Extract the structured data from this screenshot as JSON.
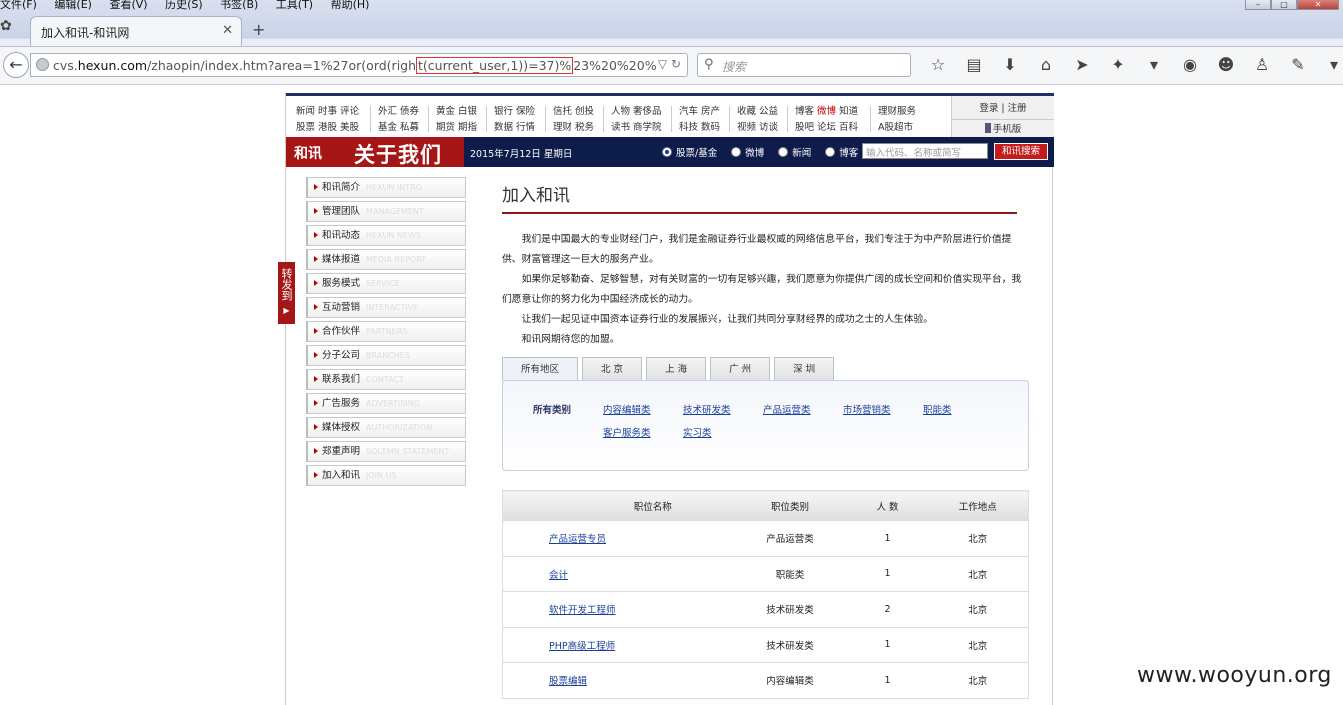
{
  "browser": {
    "menu": [
      "文件(F)",
      "编辑(E)",
      "查看(V)",
      "历史(S)",
      "书签(B)",
      "工具(T)",
      "帮助(H)"
    ],
    "tab_title": "加入和讯-和讯网",
    "url_pre": "cvs.",
    "url_host": "hexun.com",
    "url_mid": "/zhaopin/index.htm?area=1%27or(ord(righ",
    "url_hl": "t(current_user,1))=37)%",
    "url_post": "23%20%20%",
    "search_placeholder": "搜索"
  },
  "topnav": {
    "groups": [
      [
        "新闻 时事 评论",
        "股票 港股 美股"
      ],
      [
        "外汇 债券",
        "基金 私募"
      ],
      [
        "黄金 白银",
        "期货 期指"
      ],
      [
        "银行 保险",
        "数据 行情"
      ],
      [
        "信托 创投",
        "理财 税务"
      ],
      [
        "人物 奢侈品",
        "读书 商学院"
      ],
      [
        "汽车 房产",
        "科技 数码"
      ],
      [
        "收藏 公益",
        "视频 访谈"
      ],
      [
        "博客 ",
        "股吧 论坛 百科"
      ],
      [
        "理财服务",
        "A股超市"
      ]
    ],
    "weibo": "微博",
    "zhidao": " 知道",
    "login": "登录",
    "register": "注册",
    "mobile": "手机版"
  },
  "band": {
    "logo_hexun": "和讯",
    "logo_title": "关于我们",
    "date": "2015年7月12日  星期日",
    "radios": [
      "股票/基金",
      "微博",
      "新闻",
      "博客"
    ],
    "search_placeholder": "输入代码、名称或简写",
    "search_button": "和讯搜索"
  },
  "share": "转发到",
  "left_menu": [
    {
      "cn": "和讯简介",
      "en": "HEXUN INTRO"
    },
    {
      "cn": "管理团队",
      "en": "MANAGEMENT"
    },
    {
      "cn": "和讯动态",
      "en": "HEXUN NEWS"
    },
    {
      "cn": "媒体报道",
      "en": "MEDIA REPORT"
    },
    {
      "cn": "服务模式",
      "en": "SERVICE"
    },
    {
      "cn": "互动营销",
      "en": "INTERACTIVE"
    },
    {
      "cn": "合作伙伴",
      "en": "PARTNERS"
    },
    {
      "cn": "分子公司",
      "en": "BRANCHES"
    },
    {
      "cn": "联系我们",
      "en": "CONTACT"
    },
    {
      "cn": "广告服务",
      "en": "ADVERTISING"
    },
    {
      "cn": "媒体授权",
      "en": "AUTHORIZATION"
    },
    {
      "cn": "郑重声明",
      "en": "SOLEMN STATEMENT"
    },
    {
      "cn": "加入和讯",
      "en": "JOIN US"
    }
  ],
  "main": {
    "title": "加入和讯",
    "intro": [
      "我们是中国最大的专业财经门户，我们是金融证券行业最权威的网络信息平台，我们专注于为中产阶层进行价值提供、财富管理这一巨大的服务产业。",
      "如果你足够勤奋、足够智慧，对有关财富的一切有足够兴趣，我们愿意为你提供广阔的成长空间和价值实现平台，我们愿意让你的努力化为中国经济成长的动力。",
      "让我们一起见证中国资本证券行业的发展振兴，让我们共同分享财经界的成功之士的人生体验。",
      "和讯网期待您的加盟。"
    ],
    "tabs": [
      "所有地区",
      "北 京",
      "上 海",
      "广 州",
      "深 圳"
    ],
    "cat_label": "所有类别",
    "categories": [
      "内容编辑类",
      "技术研发类",
      "产品运营类",
      "市场营销类",
      "职能类",
      "客户服务类",
      "实习类"
    ],
    "table_headers": [
      "职位名称",
      "职位类别",
      "人 数",
      "工作地点"
    ],
    "rows": [
      [
        "产品运营专员",
        "产品运营类",
        "1",
        "北京"
      ],
      [
        "会计",
        "职能类",
        "1",
        "北京"
      ],
      [
        "软件开发工程师",
        "技术研发类",
        "2",
        "北京"
      ],
      [
        "PHP高级工程师",
        "技术研发类",
        "1",
        "北京"
      ],
      [
        "股票编辑",
        "内容编辑类",
        "1",
        "北京"
      ]
    ]
  },
  "watermark": "www.wooyun.org"
}
